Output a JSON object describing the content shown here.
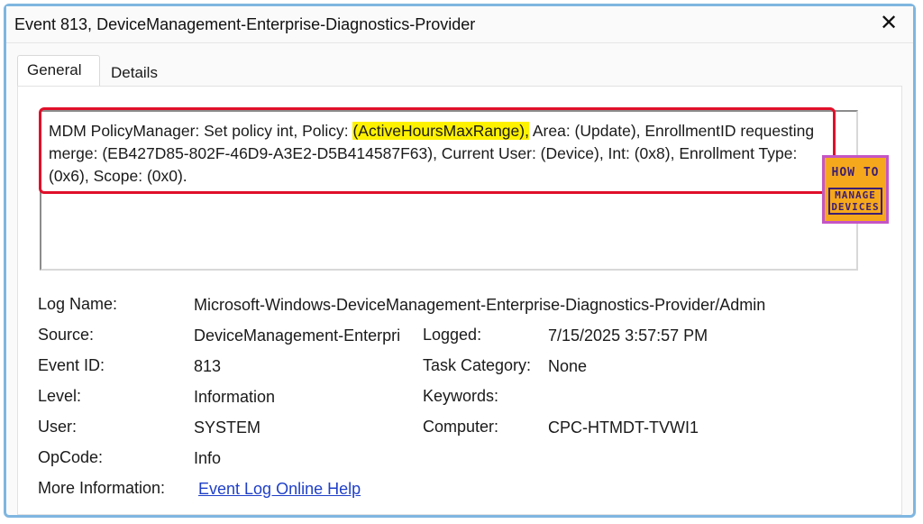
{
  "window": {
    "title": "Event 813, DeviceManagement-Enterprise-Diagnostics-Provider",
    "close_glyph": "✕"
  },
  "tabs": [
    {
      "label": "General",
      "selected": true
    },
    {
      "label": "Details",
      "selected": false
    }
  ],
  "message": {
    "before": "MDM PolicyManager: Set policy int, Policy: ",
    "highlight": "(ActiveHoursMaxRange),",
    "after": " Area: (Update), EnrollmentID requesting merge: (EB427D85-802F-46D9-A3E2-D5B414587F63), Current User: (Device), Int: (0x8), Enrollment Type: (0x6), Scope: (0x0)."
  },
  "fields": {
    "log_name": {
      "label": "Log Name:",
      "value": "Microsoft-Windows-DeviceManagement-Enterprise-Diagnostics-Provider/Admin"
    },
    "source": {
      "label": "Source:",
      "value": "DeviceManagement-Enterpri"
    },
    "logged": {
      "label": "Logged:",
      "value": "7/15/2025 3:57:57 PM"
    },
    "event_id": {
      "label": "Event ID:",
      "value": "813"
    },
    "task_category": {
      "label": "Task Category:",
      "value": "None"
    },
    "level": {
      "label": "Level:",
      "value": "Information"
    },
    "keywords": {
      "label": "Keywords:",
      "value": ""
    },
    "user": {
      "label": "User:",
      "value": "SYSTEM"
    },
    "computer": {
      "label": "Computer:",
      "value": "CPC-HTMDT-TVWI1"
    },
    "opcode": {
      "label": "OpCode:",
      "value": "Info"
    },
    "more_info": {
      "label": "More Information:",
      "link": "Event Log Online Help"
    }
  },
  "watermark": {
    "line1": "HOW TO",
    "line2": "MANAGE DEVICES"
  },
  "colors": {
    "highlight": "#fff200",
    "annotation_box": "#e0102a",
    "link": "#1f3fc8",
    "logo_bg": "#f6a81c"
  }
}
